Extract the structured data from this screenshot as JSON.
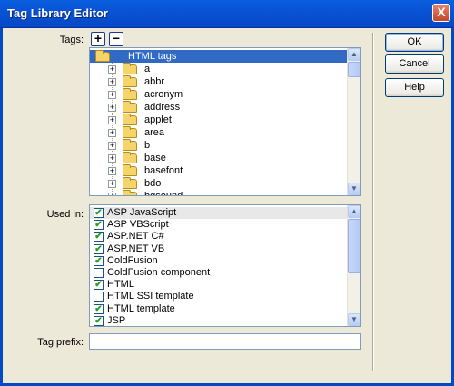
{
  "window": {
    "title": "Tag Library Editor",
    "close_glyph": "X"
  },
  "tags_label": "Tags:",
  "add_glyph": "+",
  "remove_glyph": "−",
  "tree": {
    "root": "HTML tags",
    "items": [
      "a",
      "abbr",
      "acronym",
      "address",
      "applet",
      "area",
      "b",
      "base",
      "basefont",
      "bdo",
      "bgsound"
    ]
  },
  "used_in_label": "Used in:",
  "used_in": [
    {
      "label": "ASP JavaScript",
      "checked": true
    },
    {
      "label": "ASP VBScript",
      "checked": true
    },
    {
      "label": "ASP.NET C#",
      "checked": true
    },
    {
      "label": "ASP.NET VB",
      "checked": true
    },
    {
      "label": "ColdFusion",
      "checked": true
    },
    {
      "label": "ColdFusion component",
      "checked": false
    },
    {
      "label": "HTML",
      "checked": true
    },
    {
      "label": "HTML SSI template",
      "checked": false
    },
    {
      "label": "HTML template",
      "checked": true
    },
    {
      "label": "JSP",
      "checked": true
    }
  ],
  "tag_prefix_label": "Tag prefix:",
  "tag_prefix_value": "",
  "buttons": {
    "ok": "OK",
    "cancel": "Cancel",
    "help": "Help"
  },
  "icons": {
    "check": "✔",
    "expand": "+",
    "scroll_up": "▲",
    "scroll_down": "▼"
  }
}
